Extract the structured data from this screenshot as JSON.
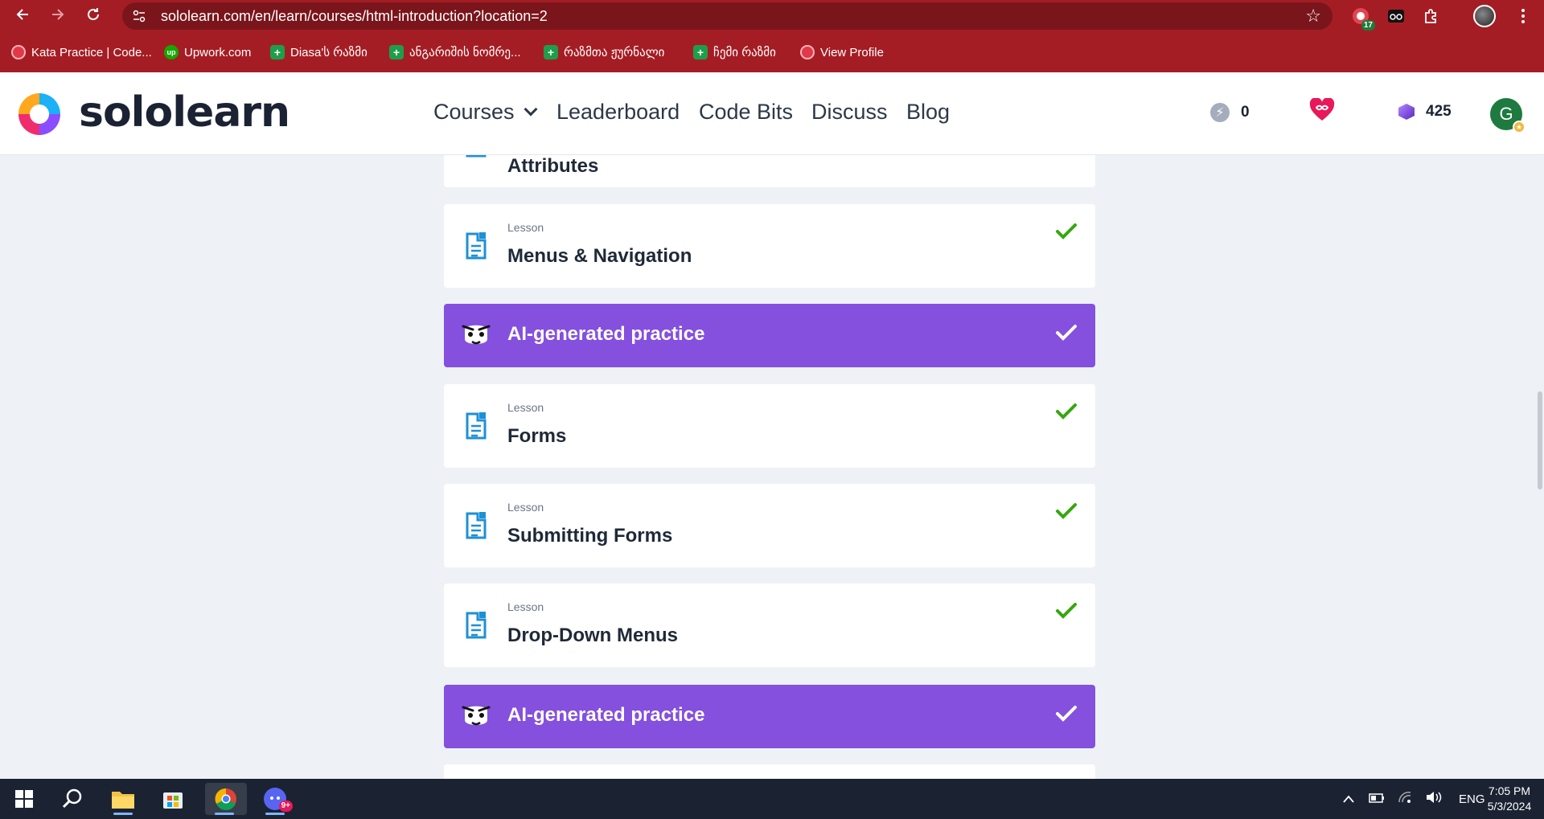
{
  "browser": {
    "url": "sololearn.com/en/learn/courses/html-introduction?location=2",
    "extension_badge": "17",
    "bookmarks": [
      {
        "label": "Kata Practice | Code...",
        "icon": "kata-icon"
      },
      {
        "label": "Upwork.com",
        "icon": "upwork-icon"
      },
      {
        "label": "Diasa'ს რაზმი",
        "icon": "sheets-icon"
      },
      {
        "label": "ანგარიშის ნომრე...",
        "icon": "sheets-icon"
      },
      {
        "label": "რაზმთა ჟურნალი",
        "icon": "sheets-icon"
      },
      {
        "label": "ჩემი რაზმი",
        "icon": "sheets-icon"
      },
      {
        "label": "View Profile",
        "icon": "kata-icon"
      }
    ]
  },
  "header": {
    "logo_text": "sololearn",
    "nav": {
      "courses": "Courses",
      "leaderboard": "Leaderboard",
      "code_bits": "Code Bits",
      "discuss": "Discuss",
      "blog": "Blog"
    },
    "streak": "0",
    "bits": "425",
    "user_initial": "G"
  },
  "course": {
    "items": [
      {
        "type": "lesson",
        "kicker": "",
        "title": "Attributes",
        "completed": true
      },
      {
        "type": "lesson",
        "kicker": "Lesson",
        "title": "Menus & Navigation",
        "completed": true
      },
      {
        "type": "practice",
        "kicker": "",
        "title": "AI-generated practice",
        "completed": true
      },
      {
        "type": "lesson",
        "kicker": "Lesson",
        "title": "Forms",
        "completed": true
      },
      {
        "type": "lesson",
        "kicker": "Lesson",
        "title": "Submitting Forms",
        "completed": true
      },
      {
        "type": "lesson",
        "kicker": "Lesson",
        "title": "Drop-Down Menus",
        "completed": true
      },
      {
        "type": "practice",
        "kicker": "",
        "title": "AI-generated practice",
        "completed": true
      }
    ]
  },
  "taskbar": {
    "discord_badge": "9+",
    "language": "ENG",
    "time": "7:05 PM",
    "date": "5/3/2024"
  },
  "colors": {
    "chrome": "#a51d24",
    "practice": "#8450dd",
    "check": "#35a80e",
    "lesson_icon": "#1e90d6"
  }
}
